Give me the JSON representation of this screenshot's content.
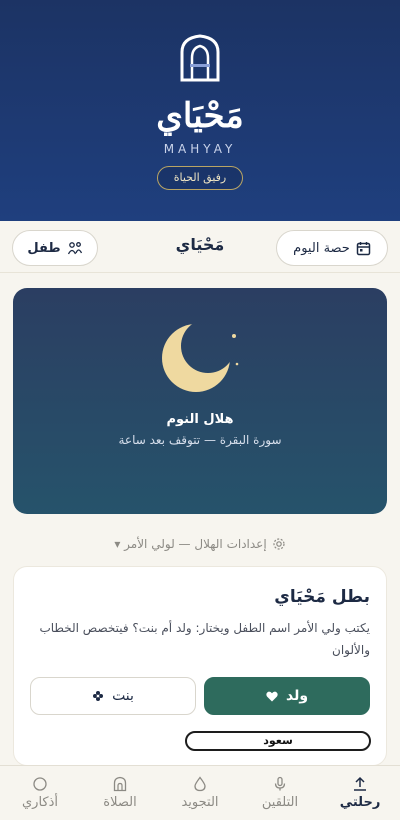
{
  "hero": {
    "title": "مَحْيَاي",
    "latin": "MAHYAY",
    "tagline": "رفيق الحياة"
  },
  "topbar": {
    "day_button": "حصة اليوم",
    "brand": "مَحْيَاي",
    "child_button": "طفل"
  },
  "moon_card": {
    "title": "هلال النوم",
    "subtitle": "سورة البقرة — تتوقف بعد ساعة"
  },
  "settings_toggle": {
    "label": "إعدادات الهلال — لولي الأمر ▾"
  },
  "hero_setup": {
    "title": "بطل مَحْيَاي",
    "description": "يكتب ولي الأمر اسم الطفل ويختار: ولد أم بنت؟ فيتخصص الخطاب والألوان",
    "boy_label": "ولد",
    "girl_label": "بنت",
    "name_value": "سعود"
  },
  "tabs": [
    {
      "label": "رحلتي",
      "icon": "upload-icon",
      "active": true
    },
    {
      "label": "التلقين",
      "icon": "microphone-icon",
      "active": false
    },
    {
      "label": "التجويد",
      "icon": "drop-icon",
      "active": false
    },
    {
      "label": "الصلاة",
      "icon": "mosque-icon",
      "active": false
    },
    {
      "label": "أذكاري",
      "icon": "circle-icon",
      "active": false
    }
  ],
  "colors": {
    "brand_navy": "#1d2a44",
    "hero_blue": "#1f3f7e",
    "accent_green": "#2e6b5d",
    "moon_gold": "#efd9a0"
  }
}
